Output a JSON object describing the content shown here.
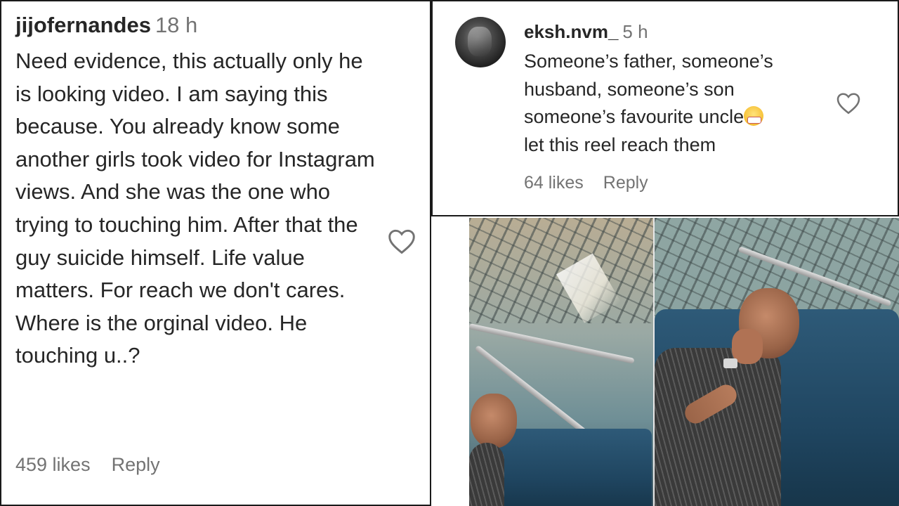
{
  "comments": [
    {
      "username": "jijofernandes",
      "time": "18 h",
      "text": "Need evidence, this actually only he is looking video. I am saying this because. You already know some another girls took video for Instagram views. And she was the one who trying to touching him. After that the guy suicide himself. Life value matters. For reach we don't cares. Where is the orginal video. He touching u..?",
      "likes": "459 likes",
      "reply_label": "Reply",
      "like_icon": "heart-outline-icon"
    },
    {
      "username": "eksh.nvm_",
      "time": "5 h",
      "text_lines": [
        "Someone’s father, someone’s",
        "husband, someone’s son",
        "someone’s favourite uncle",
        "let this reel reach them"
      ],
      "emoji": "face-with-medical-mask-grin",
      "likes": "64 likes",
      "reply_label": "Reply",
      "like_icon": "heart-outline-icon"
    }
  ],
  "colors": {
    "text_primary": "#262626",
    "text_secondary": "#737373",
    "background": "#ffffff",
    "border": "#1a1a1a"
  }
}
